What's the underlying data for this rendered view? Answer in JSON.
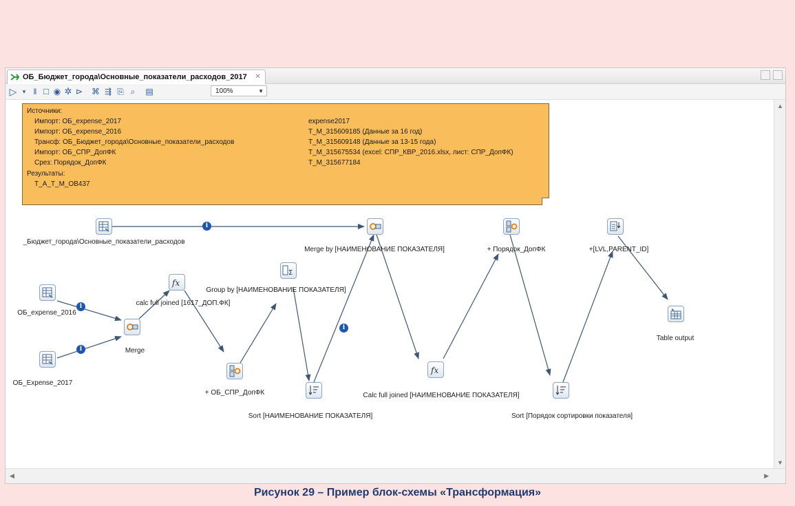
{
  "tab": {
    "title": "ОБ_Бюджет_города\\Основные_показатели_расходов_2017",
    "close_glyph": "✕"
  },
  "toolbar": {
    "zoom": "100%"
  },
  "note": {
    "heading_sources": "Источники:",
    "sources": [
      {
        "left": "Импорт: ОБ_expense_2017",
        "right": "expense2017"
      },
      {
        "left": "Импорт: ОБ_expense_2016",
        "right": "T_M_315609185 (Данные за 16 год)"
      },
      {
        "left": "Трансф: ОБ_Бюджет_города\\Основные_показатели_расходов",
        "right": "T_M_315609148 (Данные за 13-15 года)"
      },
      {
        "left": "Импорт: ОБ_СПР_ДопФК",
        "right": "T_M_315675534 (excel: СПР_КВР_2016.xlsx, лист: СПР_ДопФК)"
      },
      {
        "left": "Срез: Порядок_ДопФК",
        "right": "T_M_315677184"
      }
    ],
    "heading_results": "Результаты:",
    "result": "T_A_T_M_OB437"
  },
  "nodes": {
    "budget": "_Бюджет_города\\Основные_показатели_расходов",
    "exp2016": "ОБ_expense_2016",
    "exp2017": "ОБ_Expense_2017",
    "merge": "Merge",
    "calc": "calc full joined [1617_ДОП.ФК]",
    "spr": "+ ОБ_СПР_ДопФК",
    "group": "Group by [НАИМЕНОВАНИЕ ПОКАЗАТЕЛЯ]",
    "sort1": "Sort [НАИМЕНОВАНИЕ ПОКАЗАТЕЛЯ]",
    "mergeby": "Merge by [НАИМЕНОВАНИЕ ПОКАЗАТЕЛЯ]",
    "calc2": "Calc full joined [НАИМЕНОВАНИЕ ПОКАЗАТЕЛЯ]",
    "poryadok": "+ Порядок_ДопФК",
    "sort2": "Sort [Порядок сортировки показателя]",
    "lvl": "+[LVL,PARENT_ID]",
    "output": "Table output"
  },
  "icons": {
    "fx_glyph": "fx",
    "info_glyph": "i"
  },
  "caption": "Рисунок 29 – Пример блок-схемы «Трансформация»",
  "colors": {
    "note_bg": "#f9be5b",
    "edge": "#3f5774",
    "info_badge": "#1e56b0",
    "caption": "#1f3a6e"
  }
}
